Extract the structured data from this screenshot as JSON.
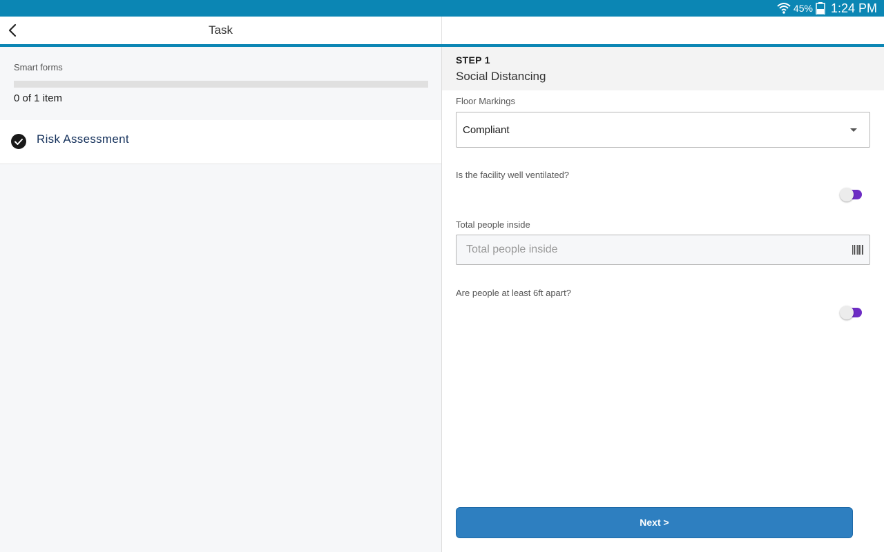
{
  "status_bar": {
    "battery_percent": "45%",
    "time": "1:24 PM",
    "icons": [
      "wifi-icon",
      "battery-icon"
    ]
  },
  "header": {
    "title": "Task",
    "back_icon": "back-arrow-icon"
  },
  "left_panel": {
    "smart_forms_label": "Smart forms",
    "progress": {
      "completed": 0,
      "total": 1,
      "fraction": 0.0,
      "text": "0 of 1 item"
    },
    "items": [
      {
        "label": "Risk Assessment",
        "icon": "check-circle-icon"
      }
    ]
  },
  "form": {
    "step_number": "STEP 1",
    "step_title": "Social Distancing",
    "floor_markings": {
      "label": "Floor Markings",
      "value": "Compliant"
    },
    "ventilated": {
      "label": "Is the facility well ventilated?"
    },
    "people_inside": {
      "label": "Total people inside",
      "placeholder": "Total people inside",
      "value": ""
    },
    "distance": {
      "label": "Are people at least 6ft apart?"
    },
    "next_label": "Next >"
  },
  "colors": {
    "accent": "#0b86b4",
    "toggle": "#6d2cc4",
    "button": "#2e7fc0"
  }
}
